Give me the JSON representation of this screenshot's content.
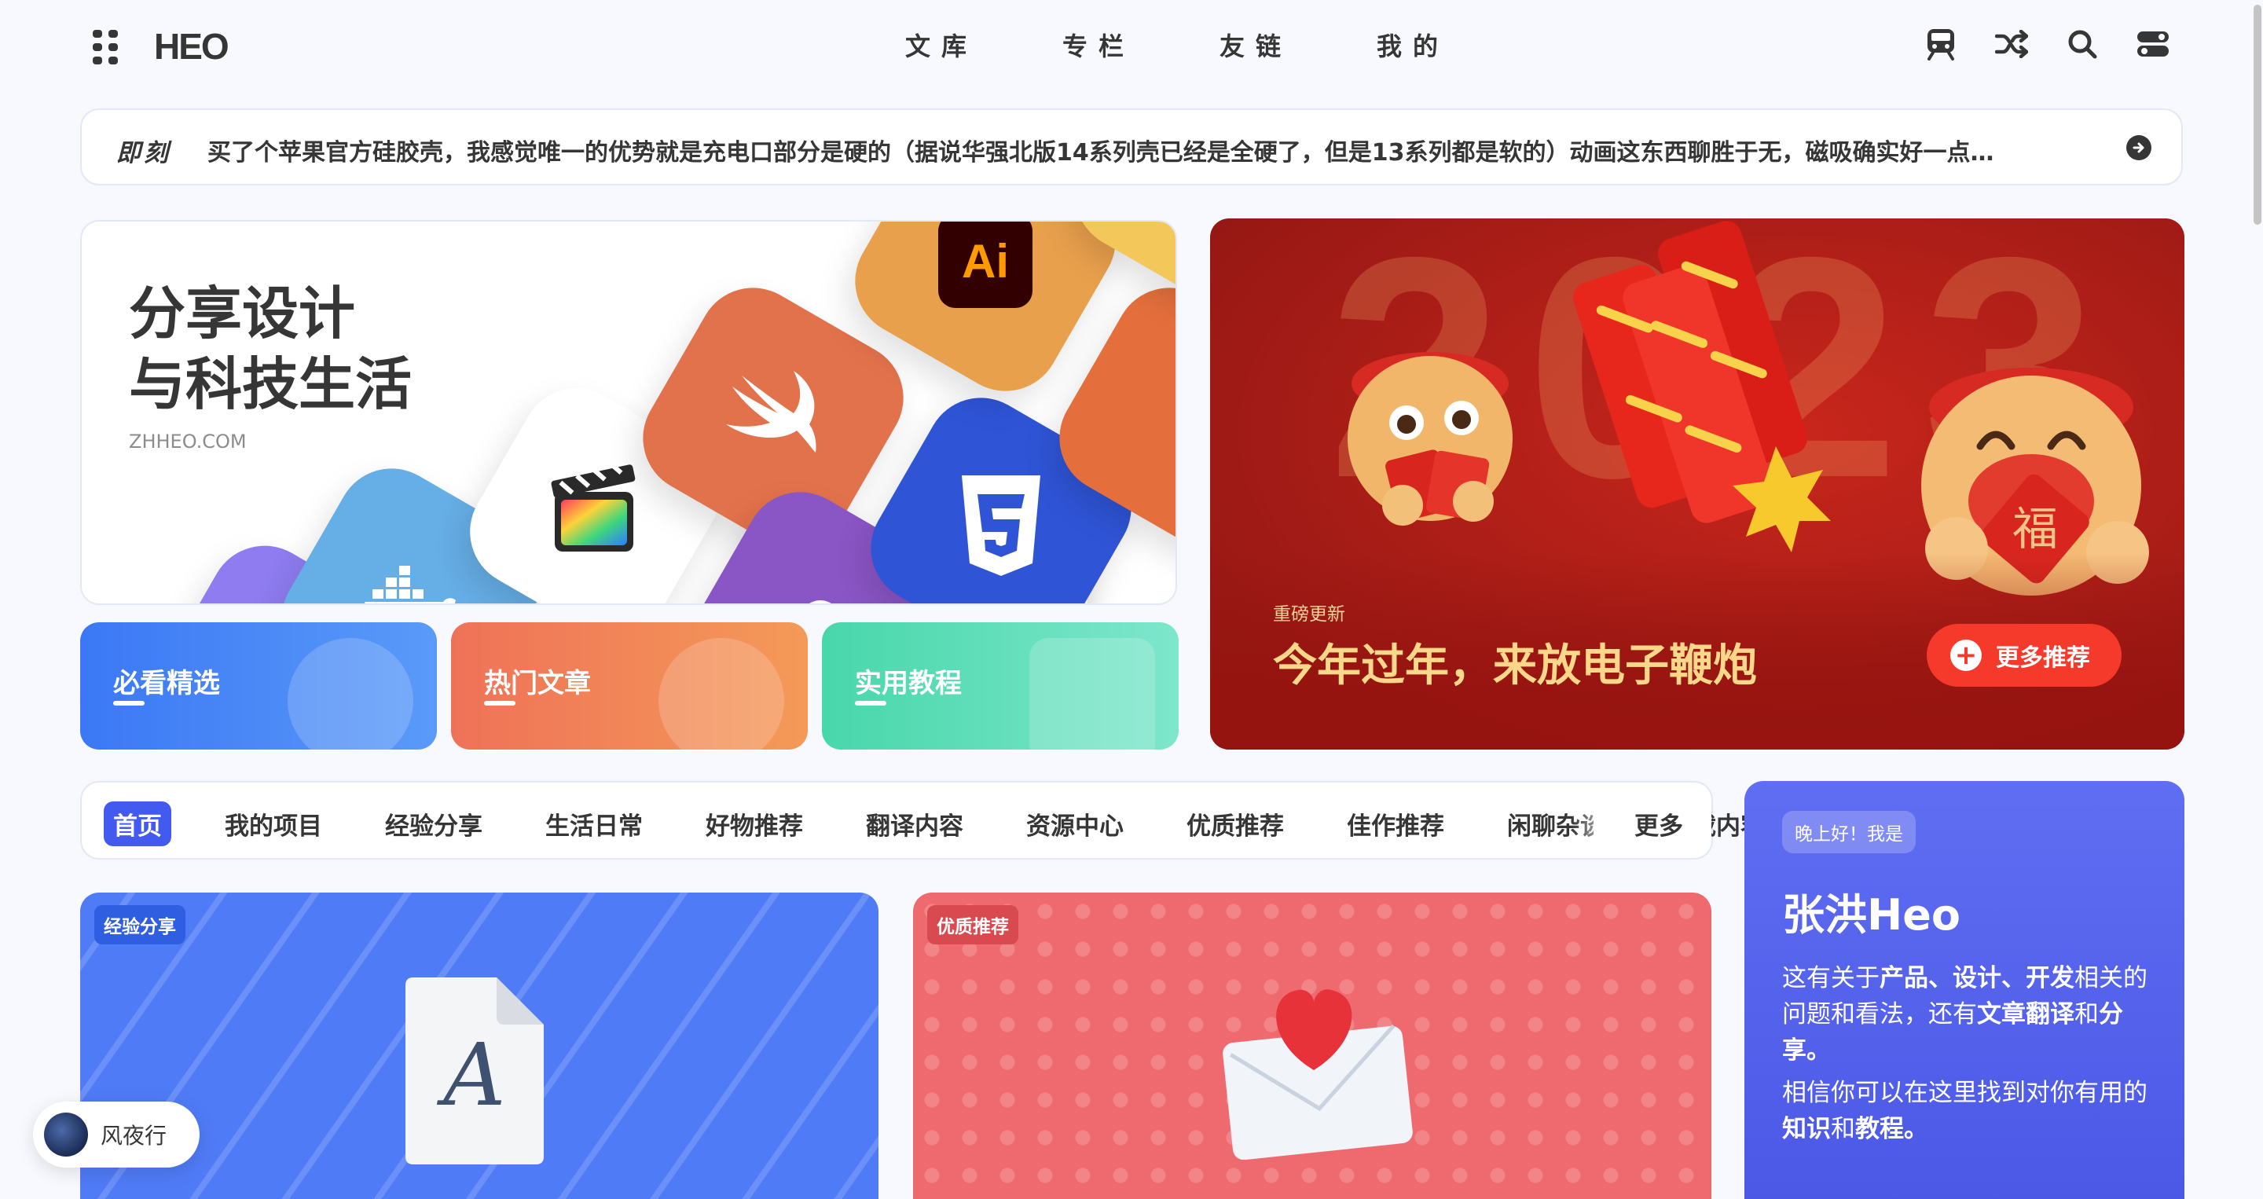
{
  "header": {
    "logo": "HEO",
    "menu": [
      "文库",
      "专栏",
      "友链",
      "我的"
    ],
    "icons": [
      "subway-icon",
      "shuffle-icon",
      "search-icon",
      "toggle-icon"
    ]
  },
  "bber": {
    "label": "即刻",
    "text": "买了个苹果官方硅胶壳，我感觉唯一的优势就是充电口部分是硬的（据说华强北版14系列壳已经是全硬了，但是13系列都是软的）动画这东西聊胜于无，磁吸确实好一点…"
  },
  "hero": {
    "title_line1": "分享设计",
    "title_line2": "与科技生活",
    "subtitle": "ZHHEO.COM",
    "tile_ai_text": "Ai"
  },
  "categories": [
    {
      "label": "必看精选",
      "color": "#3e7cf6"
    },
    {
      "label": "热门文章",
      "color": "#f0765b"
    },
    {
      "label": "实用教程",
      "color": "#4fd8b0"
    }
  ],
  "promo": {
    "tag": "重磅更新",
    "title": "今年过年，来放电子鞭炮",
    "button": "更多推荐",
    "bg_year": "2023",
    "fu": "福"
  },
  "catbar": {
    "items": [
      "首页",
      "我的项目",
      "经验分享",
      "生活日常",
      "好物推荐",
      "翻译内容",
      "资源中心",
      "优质推荐",
      "佳作推荐",
      "闲聊杂谈",
      "转载内容"
    ],
    "more": "更多"
  },
  "posts": [
    {
      "tag": "经验分享",
      "color": "#4f7bf6",
      "glyph": "A"
    },
    {
      "tag": "优质推荐",
      "color": "#ee6a6e"
    }
  ],
  "author": {
    "greeting": "晚上好！我是",
    "name": "张洪Heo",
    "desc_1a": "这有关于",
    "desc_1b": "产品、设计、开发",
    "desc_1c": "相关的问题和看法，还有",
    "desc_1d": "文章翻译",
    "desc_1e": "和",
    "desc_1f": "分享。",
    "desc_2a": "相信你可以在这里找到对你有用的",
    "desc_2b": "知识",
    "desc_2c": "和",
    "desc_2d": "教程。"
  },
  "music": {
    "title": "风夜行"
  }
}
